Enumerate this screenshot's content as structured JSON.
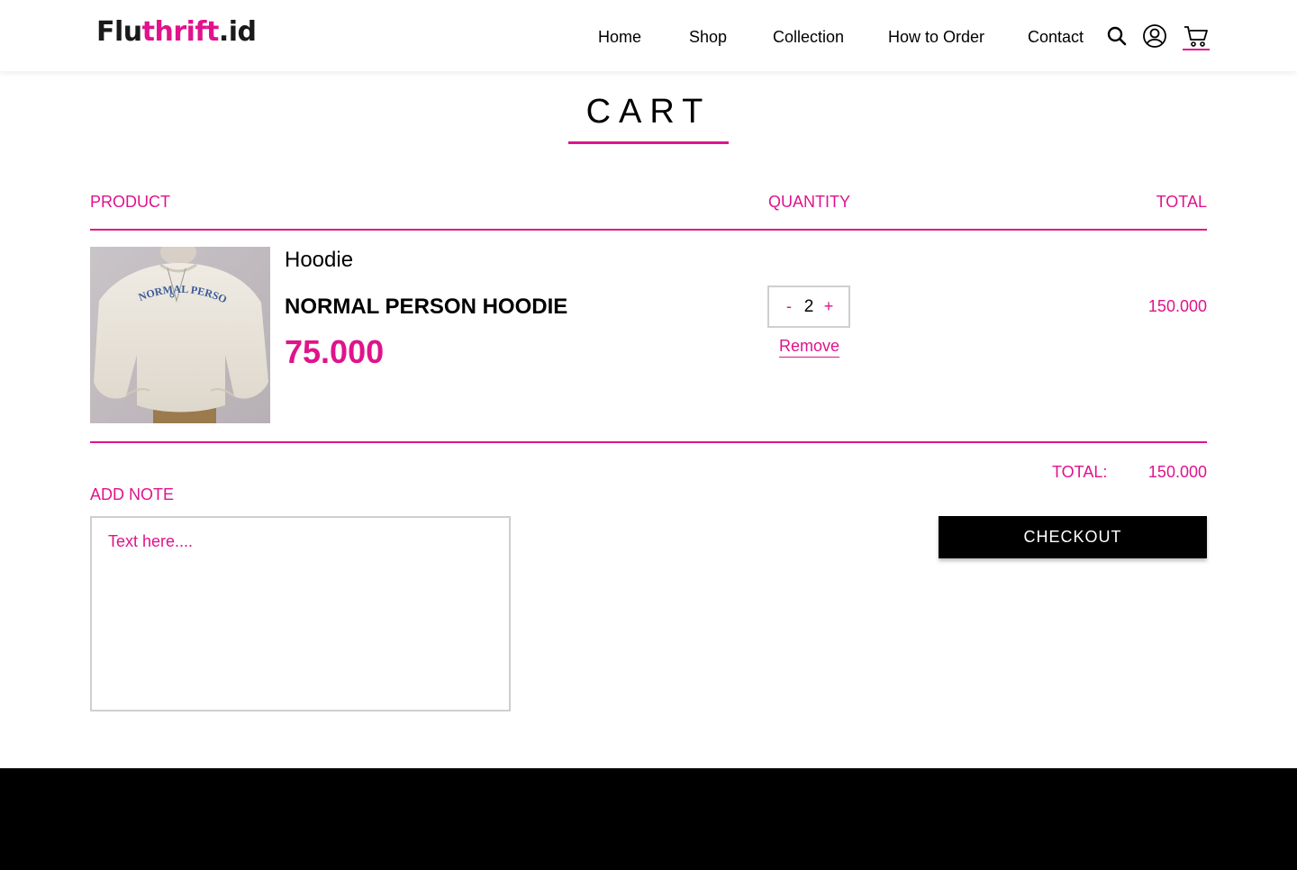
{
  "header": {
    "logo_part1": "Flu",
    "logo_part2": "thrift",
    "logo_part3": ".id",
    "nav": [
      "Home",
      "Shop",
      "Collection",
      "How to Order",
      "Contact"
    ],
    "icons": [
      "search-icon",
      "account-icon",
      "cart-icon"
    ]
  },
  "page": {
    "title": "CART"
  },
  "table": {
    "headers": {
      "product": "PRODUCT",
      "quantity": "QUANTITY",
      "total": "TOTAL"
    }
  },
  "cart_items": [
    {
      "category": "Hoodie",
      "name": "NORMAL PERSON HOODIE",
      "price": "75.000",
      "quantity": "2",
      "decrement_label": "-",
      "increment_label": "+",
      "remove_label": "Remove",
      "line_total": "150.000",
      "image_print": "NORMAL PERSON"
    }
  ],
  "summary": {
    "label": "TOTAL:",
    "value": "150.000"
  },
  "note": {
    "label": "ADD NOTE",
    "placeholder": "Text here...."
  },
  "checkout_label": "CHECKOUT",
  "colors": {
    "accent": "#e0138c",
    "footer": "#000000"
  }
}
